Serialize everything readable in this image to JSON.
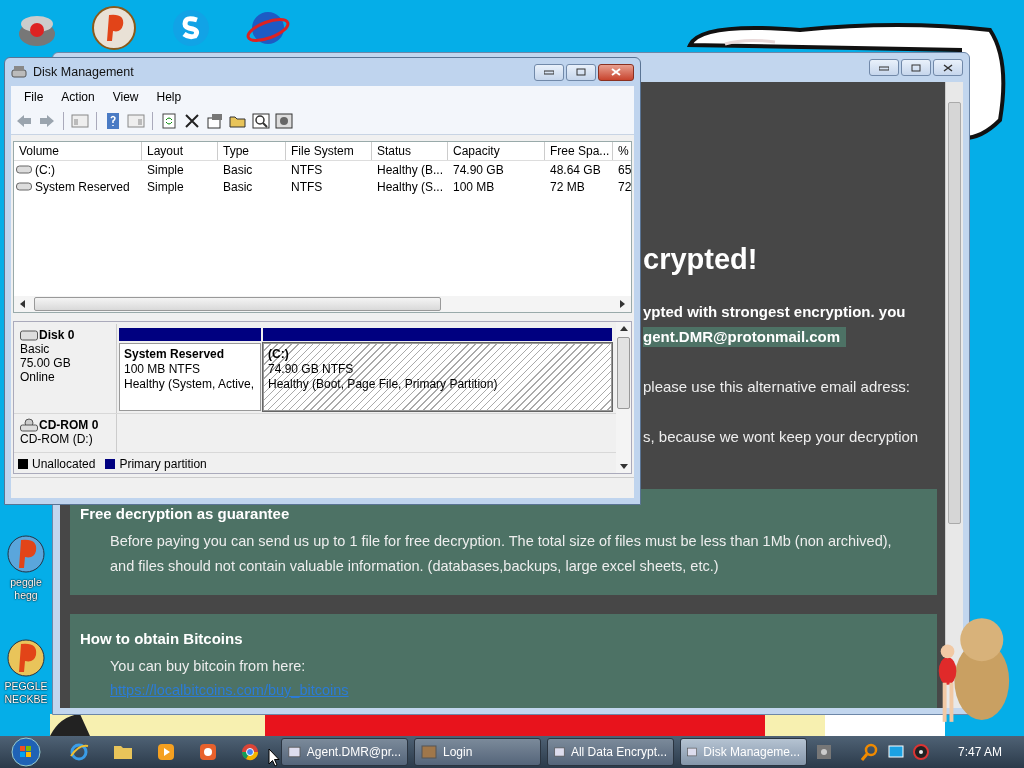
{
  "disk_management": {
    "title": "Disk Management",
    "menu": [
      "File",
      "Action",
      "View",
      "Help"
    ],
    "columns": [
      "Volume",
      "Layout",
      "Type",
      "File System",
      "Status",
      "Capacity",
      "Free Spa...",
      "%"
    ],
    "rows": [
      [
        "(C:)",
        "Simple",
        "Basic",
        "NTFS",
        "Healthy (B...",
        "74.90 GB",
        "48.64 GB",
        "65"
      ],
      [
        "System Reserved",
        "Simple",
        "Basic",
        "NTFS",
        "Healthy (S...",
        "100 MB",
        "72 MB",
        "72"
      ]
    ],
    "disks": [
      {
        "kind": "disk",
        "name": "Disk 0",
        "lines": [
          "Basic",
          "75.00 GB",
          "Online"
        ],
        "partitions": [
          {
            "name": "System Reserved",
            "lines": [
              "100 MB NTFS",
              "Healthy (System, Active,"
            ],
            "selected": false
          },
          {
            "name": "(C:)",
            "lines": [
              "74.90 GB NTFS",
              "Healthy (Boot, Page File, Primary Partition)"
            ],
            "selected": true
          }
        ]
      },
      {
        "kind": "cdrom",
        "name": "CD-ROM 0",
        "lines": [
          "CD-ROM (D:)"
        ]
      }
    ],
    "legend": [
      {
        "label": "Unallocated",
        "color": "#000000"
      },
      {
        "label": "Primary partition",
        "color": "#000080"
      }
    ]
  },
  "ransom_note": {
    "heading": "crypted!",
    "lines": [
      {
        "kind": "bold",
        "text": "ypted with strongest encryption. you"
      },
      {
        "kind": "email",
        "text": "gent.DMR@protonmail.com"
      },
      {
        "kind": "plain",
        "text": "please use this alternative email adress:"
      },
      {
        "kind": "plain",
        "text": "s, because we wont keep your decryption"
      }
    ],
    "sections": [
      {
        "title": "Free decryption as guarantee",
        "paragraphs": [
          "Before paying you can send us up to 1 file for free decryption. The total size of files must be less than 1Mb (non archived), and files should not contain valuable information. (databases,backups, large excel sheets, etc.)"
        ]
      },
      {
        "title": "How to obtain Bitcoins",
        "paragraphs": [
          "You can buy bitcoin from here:"
        ],
        "link": "https://localbitcoins.com/buy_bitcoins"
      }
    ]
  },
  "desktop_icons": [
    {
      "lines": [
        "peggle",
        "hegg"
      ]
    },
    {
      "lines": [
        "PEGGLE",
        "NECKBE"
      ]
    }
  ],
  "taskbar": {
    "tasks": [
      {
        "label": "Agent.DMR@pr...",
        "selected": false
      },
      {
        "label": "Login",
        "selected": false
      },
      {
        "label": "All Data Encrypt...",
        "selected": false
      },
      {
        "label": "Disk Manageme...",
        "selected": true
      }
    ],
    "clock": "7:47 AM"
  }
}
